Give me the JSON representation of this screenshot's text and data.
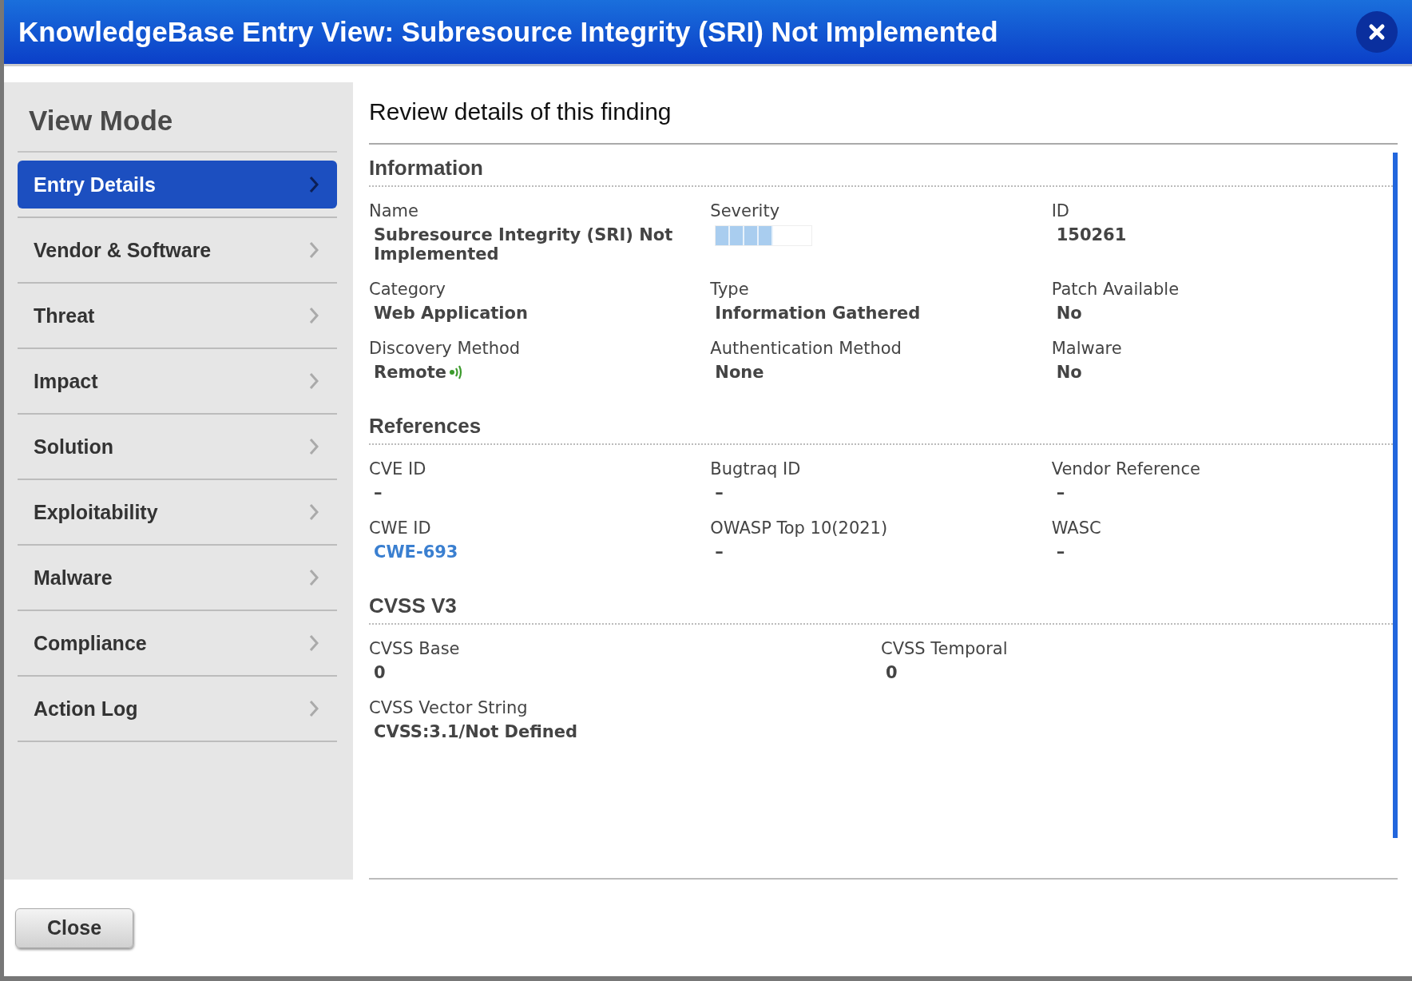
{
  "window": {
    "title": "KnowledgeBase Entry View: Subresource Integrity (SRI) Not Implemented"
  },
  "sidebar": {
    "title": "View Mode",
    "items": [
      {
        "label": "Entry Details",
        "selected": true
      },
      {
        "label": "Vendor & Software",
        "selected": false
      },
      {
        "label": "Threat",
        "selected": false
      },
      {
        "label": "Impact",
        "selected": false
      },
      {
        "label": "Solution",
        "selected": false
      },
      {
        "label": "Exploitability",
        "selected": false
      },
      {
        "label": "Malware",
        "selected": false
      },
      {
        "label": "Compliance",
        "selected": false
      },
      {
        "label": "Action Log",
        "selected": false
      }
    ]
  },
  "content": {
    "heading": "Review details of this finding",
    "sections": [
      {
        "title": "Information",
        "rows": [
          [
            {
              "label": "Name",
              "kind": "text",
              "value": "Subresource Integrity (SRI) Not Implemented"
            },
            {
              "label": "Severity",
              "kind": "severity",
              "level": 0.6
            },
            {
              "label": "ID",
              "kind": "text",
              "value": "150261"
            }
          ],
          [
            {
              "label": "Category",
              "kind": "text",
              "value": "Web Application"
            },
            {
              "label": "Type",
              "kind": "text",
              "value": "Information Gathered"
            },
            {
              "label": "Patch Available",
              "kind": "text",
              "value": "No"
            }
          ],
          [
            {
              "label": "Discovery Method",
              "kind": "signal",
              "value": "Remote"
            },
            {
              "label": "Authentication Method",
              "kind": "text",
              "value": "None"
            },
            {
              "label": "Malware",
              "kind": "text",
              "value": "No"
            }
          ]
        ]
      },
      {
        "title": "References",
        "rows": [
          [
            {
              "label": "CVE ID",
              "kind": "text",
              "value": "–"
            },
            {
              "label": "Bugtraq ID",
              "kind": "text",
              "value": "–"
            },
            {
              "label": "Vendor Reference",
              "kind": "text",
              "value": "–"
            }
          ],
          [
            {
              "label": "CWE ID",
              "kind": "link",
              "value": "CWE-693"
            },
            {
              "label": "OWASP Top 10(2021)",
              "kind": "text",
              "value": "–"
            },
            {
              "label": "WASC",
              "kind": "text",
              "value": "–"
            }
          ]
        ]
      },
      {
        "title": "CVSS V3",
        "rows": [
          [
            {
              "label": "CVSS Base",
              "kind": "text",
              "value": "0"
            },
            {
              "label": "CVSS Temporal",
              "kind": "text",
              "value": "0"
            }
          ],
          [
            {
              "label": "CVSS Vector String",
              "kind": "text",
              "value": "CVSS:3.1/Not Defined"
            }
          ]
        ]
      }
    ]
  },
  "footer": {
    "button": "Close"
  }
}
